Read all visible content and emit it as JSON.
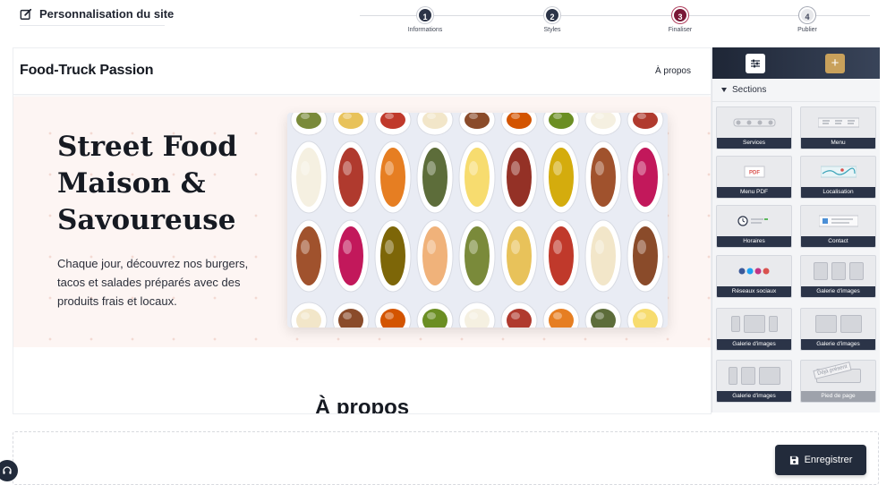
{
  "editor": {
    "title": "Personnalisation du site",
    "save_label": "Enregistrer"
  },
  "steps": [
    {
      "number": "1",
      "label": "Informations",
      "state": "done"
    },
    {
      "number": "2",
      "label": "Styles",
      "state": "done"
    },
    {
      "number": "3",
      "label": "Finaliser",
      "state": "active"
    },
    {
      "number": "4",
      "label": "Publier",
      "state": "todo"
    }
  ],
  "site": {
    "brand": "Food-Truck Passion",
    "nav_link": "À propos",
    "hero_title": "Street Food Maison & Savoureuse",
    "hero_text": "Chaque jour, découvrez nos burgers, tacos et salades préparés avec des produits frais et locaux.",
    "section_title": "À propos"
  },
  "panel": {
    "sections_label": "Sections",
    "cards": [
      {
        "label": "Services"
      },
      {
        "label": "Menu"
      },
      {
        "label": "Menu PDF"
      },
      {
        "label": "Localisation"
      },
      {
        "label": "Horaires"
      },
      {
        "label": "Contact"
      },
      {
        "label": "Réseaux sociaux"
      },
      {
        "label": "Galerie d'images"
      },
      {
        "label": "Galerie d'images"
      },
      {
        "label": "Galerie d'images"
      },
      {
        "label": "Galerie d'images"
      },
      {
        "label": "Pied de page",
        "stamp": "Déjà présent"
      }
    ]
  },
  "colors": {
    "navy": "#222b3b",
    "active_step": "#7a1736",
    "gold": "#c9a15b",
    "hero_bg": "#fdf5f3"
  }
}
